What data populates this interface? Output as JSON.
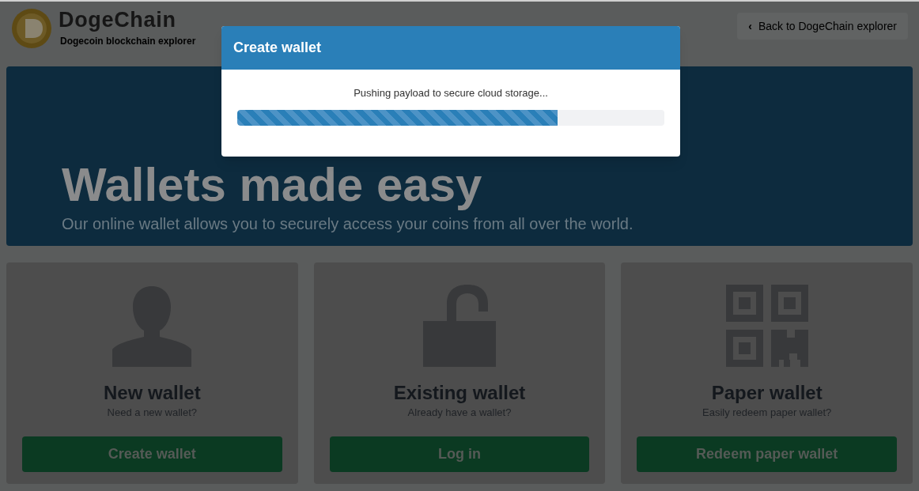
{
  "header": {
    "logo_text": "DogeChain",
    "tagline": "Dogecoin blockchain explorer",
    "back_button": {
      "icon": "‹",
      "label": "Back to DogeChain explorer"
    }
  },
  "hero": {
    "title": "Wallets made easy",
    "subtitle": "Our online wallet allows you to securely access your coins from all over the world."
  },
  "cards": [
    {
      "kind": "person",
      "title": "New wallet",
      "subtitle": "Need a new wallet?",
      "button": "Create wallet"
    },
    {
      "kind": "lock",
      "title": "Existing wallet",
      "subtitle": "Already have a wallet?",
      "button": "Log in"
    },
    {
      "kind": "qr",
      "title": "Paper wallet",
      "subtitle": "Easily redeem paper wallet?",
      "button": "Redeem paper wallet"
    }
  ],
  "modal": {
    "title": "Create wallet",
    "message": "Pushing payload to secure cloud storage...",
    "progress": {
      "level": 0.75
    }
  }
}
